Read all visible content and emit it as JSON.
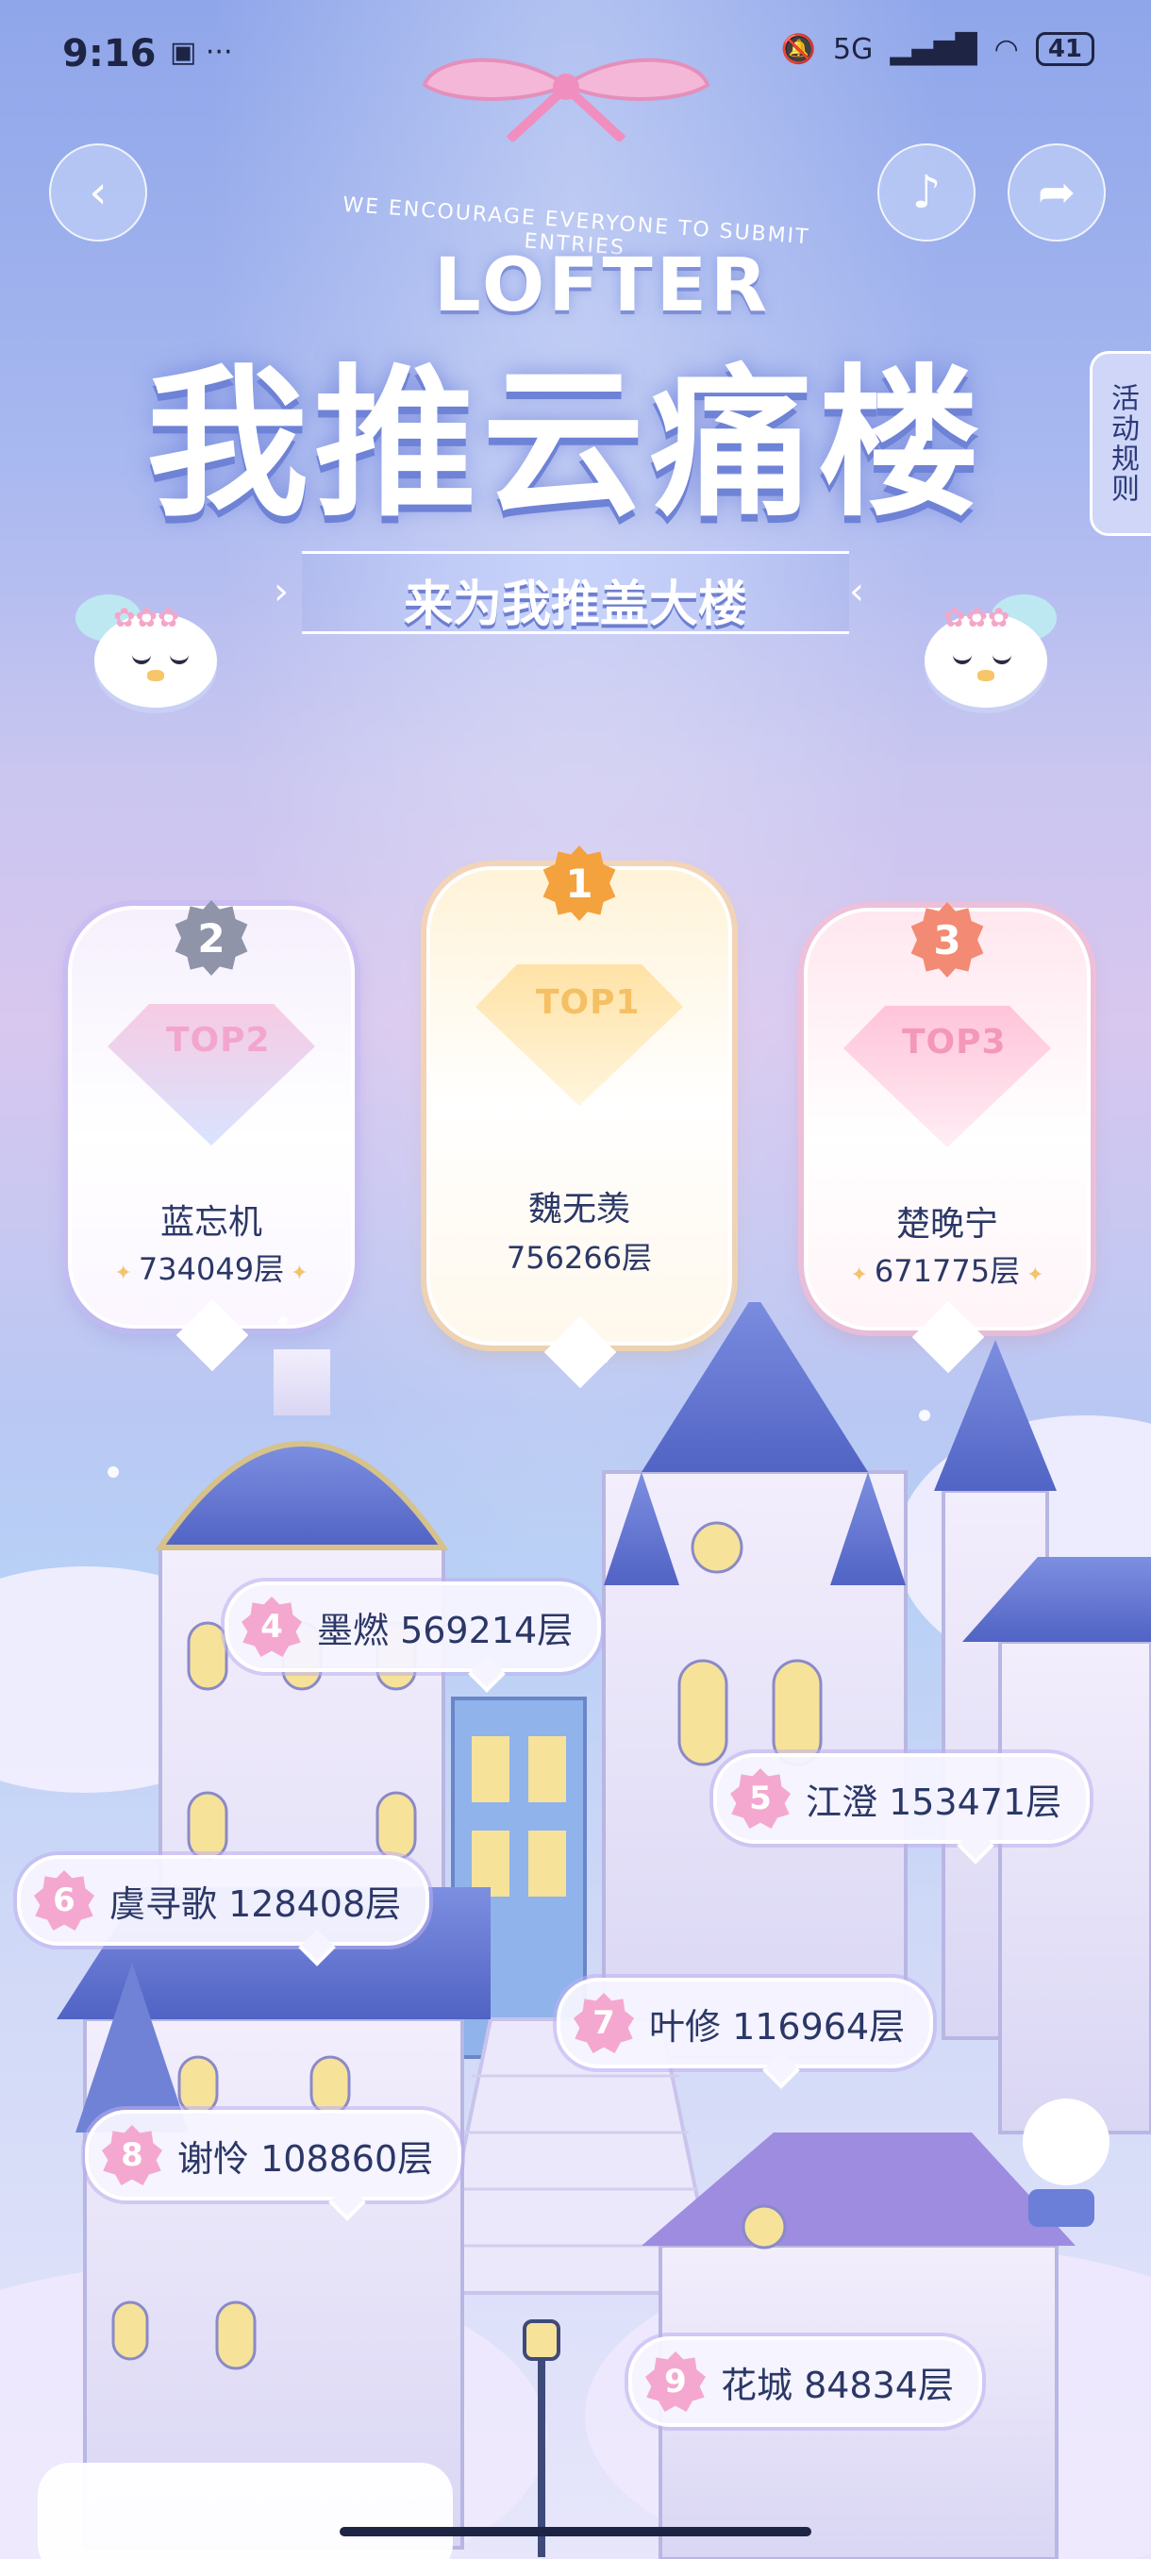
{
  "status_bar": {
    "time": "9:16",
    "left_icons": "▣ ···",
    "network": "5G",
    "battery": "41"
  },
  "nav": {
    "back_icon": "back-arrow-icon",
    "music_icon": "music-note-icon",
    "share_icon": "share-arrow-icon",
    "rules_label": "活动规则"
  },
  "header": {
    "tagline": "WE ENCOURAGE EVERYONE TO SUBMIT ENTRIES",
    "brand": "LOFTER",
    "title": "我推云痛楼",
    "subtitle": "来为我推盖大楼"
  },
  "podium": [
    {
      "rank": "2",
      "gem": "TOP2",
      "name": "蓝忘机",
      "score": "734049层",
      "color": "#8f94a8"
    },
    {
      "rank": "1",
      "gem": "TOP1",
      "name": "魏无羡",
      "score": "756266层",
      "color": "#f3a23e"
    },
    {
      "rank": "3",
      "gem": "TOP3",
      "name": "楚晚宁",
      "score": "671775层",
      "color": "#f38a73"
    }
  ],
  "ranking": [
    {
      "rank": "4",
      "text": "墨燃 569214层"
    },
    {
      "rank": "5",
      "text": "江澄 153471层"
    },
    {
      "rank": "6",
      "text": "虞寻歌 128408层"
    },
    {
      "rank": "7",
      "text": "叶修 116964层"
    },
    {
      "rank": "8",
      "text": "谢怜 108860层"
    },
    {
      "rank": "9",
      "text": "花城 84834层"
    }
  ]
}
